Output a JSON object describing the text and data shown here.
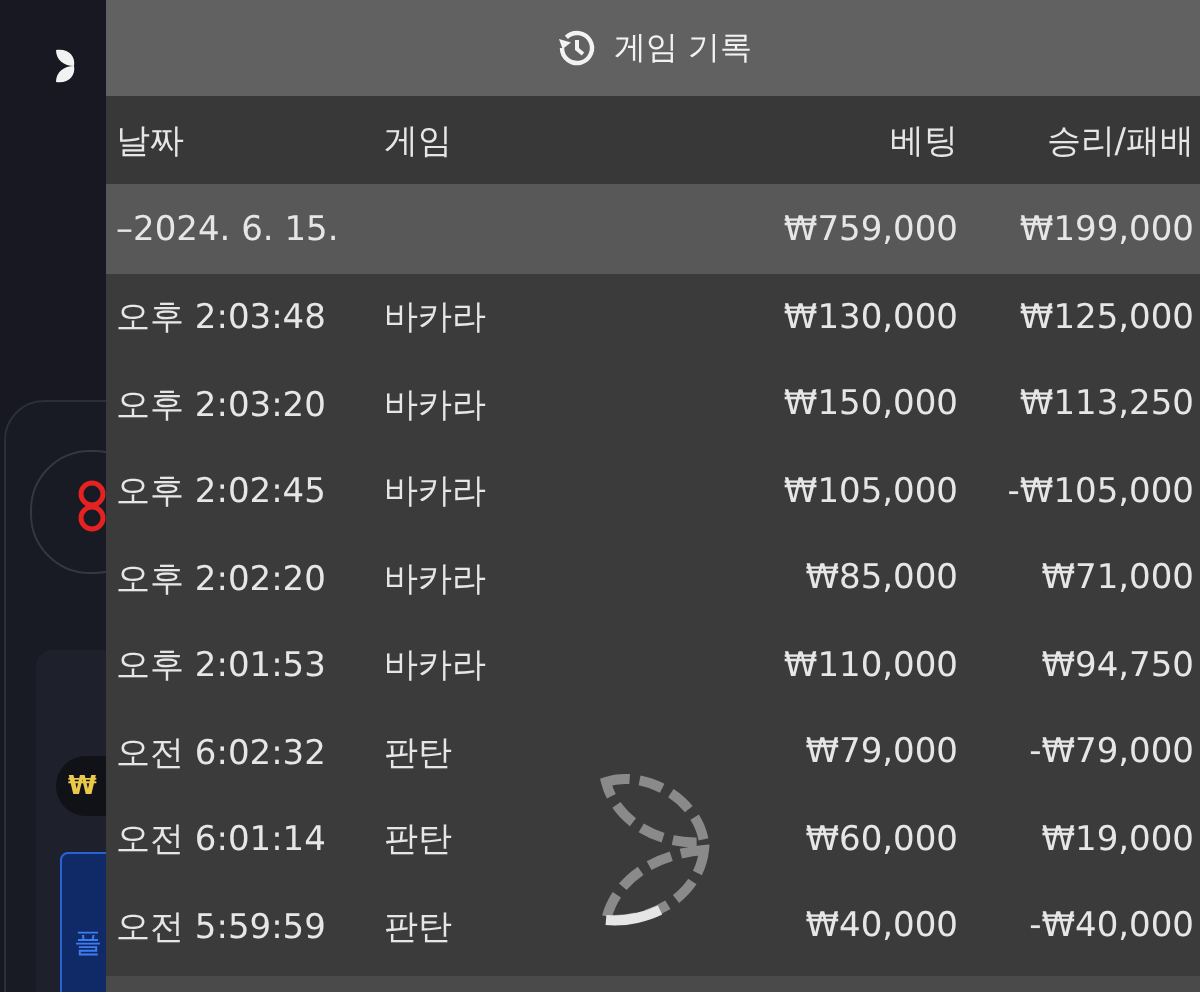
{
  "background": {
    "coin_symbol": "₩",
    "button_label": "플"
  },
  "modal": {
    "title": "게임 기록",
    "columns": [
      "날짜",
      "게임",
      "베팅",
      "승리/패배"
    ],
    "group": {
      "date": "–2024. 6. 15.",
      "bet": "₩759,000",
      "result": "₩199,000"
    },
    "rows": [
      {
        "time": "오후 2:03:48",
        "game": "바카라",
        "bet": "₩130,000",
        "result": "₩125,000"
      },
      {
        "time": "오후 2:03:20",
        "game": "바카라",
        "bet": "₩150,000",
        "result": "₩113,250"
      },
      {
        "time": "오후 2:02:45",
        "game": "바카라",
        "bet": "₩105,000",
        "result": "-₩105,000"
      },
      {
        "time": "오후 2:02:20",
        "game": "바카라",
        "bet": "₩85,000",
        "result": "₩71,000"
      },
      {
        "time": "오후 2:01:53",
        "game": "바카라",
        "bet": "₩110,000",
        "result": "₩94,750"
      },
      {
        "time": "오전 6:02:32",
        "game": "판탄",
        "bet": "₩79,000",
        "result": "-₩79,000"
      },
      {
        "time": "오전 6:01:14",
        "game": "판탄",
        "bet": "₩60,000",
        "result": "₩19,000"
      },
      {
        "time": "오전 5:59:59",
        "game": "판탄",
        "bet": "₩40,000",
        "result": "-₩40,000"
      }
    ]
  }
}
